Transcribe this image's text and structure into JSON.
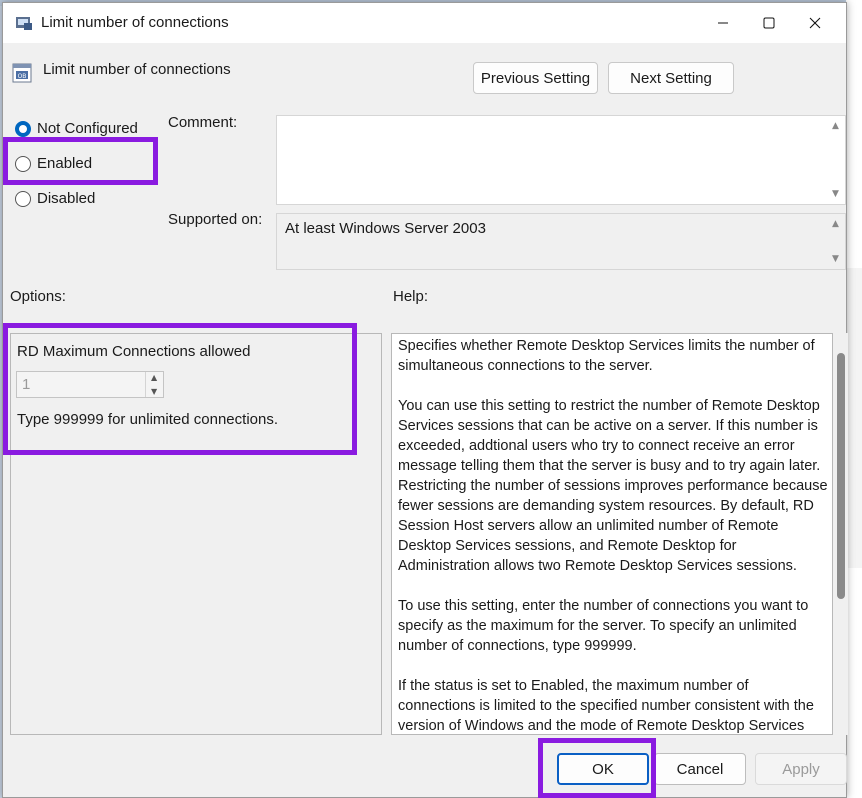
{
  "window": {
    "title": "Limit number of connections",
    "controls": {
      "minimize": "—",
      "maximize": "☐",
      "close": "✕"
    }
  },
  "header": {
    "policy_name": "Limit number of connections",
    "previous_label": "Previous Setting",
    "next_label": "Next Setting"
  },
  "state": {
    "options": [
      {
        "label": "Not Configured",
        "checked": true
      },
      {
        "label": "Enabled",
        "checked": false
      },
      {
        "label": "Disabled",
        "checked": false
      }
    ]
  },
  "comment": {
    "label": "Comment:",
    "value": ""
  },
  "supported": {
    "label": "Supported on:",
    "value": "At least Windows Server 2003"
  },
  "options_section": {
    "label": "Options:",
    "field_label": "RD Maximum Connections allowed",
    "value": "1",
    "hint": "Type 999999 for unlimited connections."
  },
  "help_section": {
    "label": "Help:",
    "paragraphs": [
      "Specifies whether Remote Desktop Services limits the number of simultaneous connections to the server.",
      "You can use this setting to restrict the number of Remote Desktop Services sessions that can be active on a server. If this number is exceeded, addtional users who try to connect receive an error message telling them that the server is busy and to try again later. Restricting the number of sessions improves performance because fewer sessions are demanding system resources. By default, RD Session Host servers allow an unlimited number of Remote Desktop Services sessions, and Remote Desktop for Administration allows two Remote Desktop Services sessions.",
      "To use this setting, enter the number of connections you want to specify as the maximum for the server. To specify an unlimited number of connections, type 999999.",
      "If the status is set to Enabled, the maximum number of connections is limited to the specified number consistent with the version of Windows and the mode of Remote Desktop Services"
    ]
  },
  "footer": {
    "ok_label": "OK",
    "cancel_label": "Cancel",
    "apply_label": "Apply"
  },
  "colors": {
    "highlight": "#8a1be0",
    "accent": "#0067c0"
  }
}
